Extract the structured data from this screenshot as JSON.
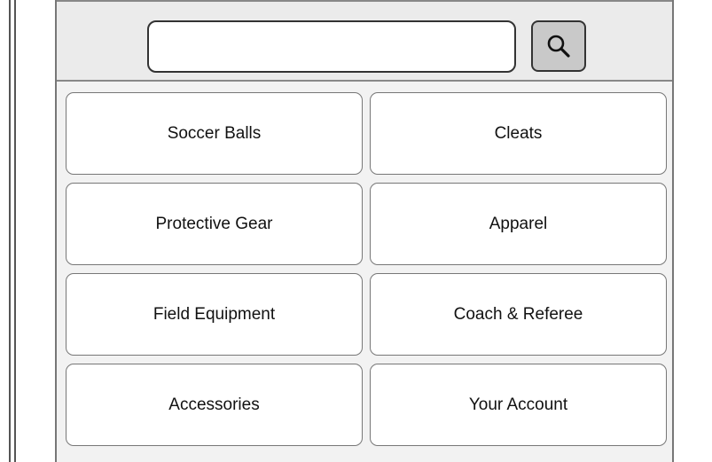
{
  "search": {
    "placeholder": "",
    "value": "",
    "button_icon": "search-icon"
  },
  "categories": [
    {
      "label": "Soccer Balls"
    },
    {
      "label": "Cleats"
    },
    {
      "label": "Protective Gear"
    },
    {
      "label": "Apparel"
    },
    {
      "label": "Field Equipment"
    },
    {
      "label": "Coach & Referee"
    },
    {
      "label": "Accessories"
    },
    {
      "label": "Your Account"
    }
  ]
}
